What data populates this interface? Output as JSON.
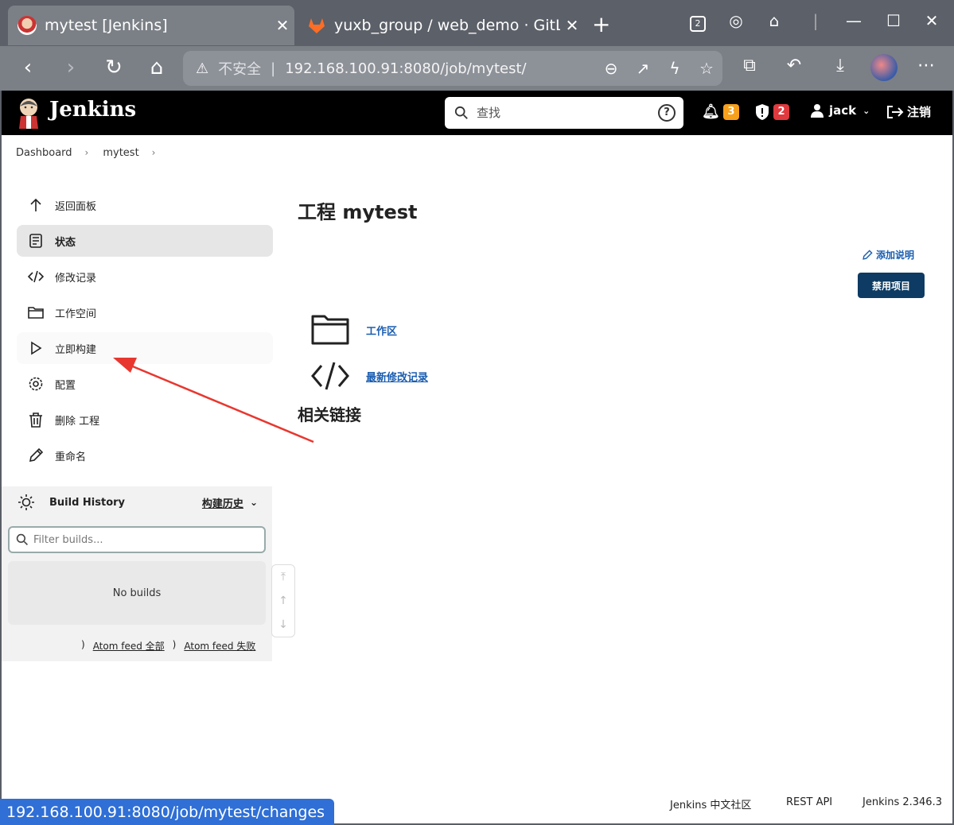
{
  "browser": {
    "tabs": [
      {
        "title": "mytest [Jenkins]",
        "active": true
      },
      {
        "title": "yuxb_group / web_demo · GitLab",
        "active": false
      }
    ],
    "tab_count": "2",
    "insecure_label": "不安全",
    "url": "192.168.100.91:8080/job/mytest/",
    "status_url": "192.168.100.91:8080/job/mytest/changes"
  },
  "header": {
    "brand": "Jenkins",
    "search_placeholder": "查找",
    "notifications_count": "3",
    "security_count": "2",
    "user": "jack",
    "logout": "注销",
    "colors": {
      "notif": "#f7a01b",
      "security": "#e0393e"
    }
  },
  "breadcrumb": [
    "Dashboard",
    "mytest"
  ],
  "sidebar": {
    "items": [
      {
        "label": "返回面板",
        "icon": "arrow-up-icon"
      },
      {
        "label": "状态",
        "icon": "document-icon"
      },
      {
        "label": "修改记录",
        "icon": "code-icon"
      },
      {
        "label": "工作空间",
        "icon": "folder-icon"
      },
      {
        "label": "立即构建",
        "icon": "play-icon"
      },
      {
        "label": "配置",
        "icon": "gear-icon"
      },
      {
        "label": "删除 工程",
        "icon": "trash-icon"
      },
      {
        "label": "重命名",
        "icon": "pencil-icon"
      }
    ]
  },
  "build_history": {
    "title": "Build History",
    "link": "构建历史",
    "filter_placeholder": "Filter builds...",
    "empty": "No builds",
    "feed_all": "Atom feed 全部",
    "feed_fail": "Atom feed 失败"
  },
  "main": {
    "title": "工程 mytest",
    "add_description": "添加说明",
    "disable_button": "禁用项目",
    "links": [
      {
        "label": "工作区",
        "icon": "folder-icon"
      },
      {
        "label": "最新修改记录",
        "icon": "code-icon"
      }
    ],
    "related": "相关链接"
  },
  "footer": {
    "community": "Jenkins 中文社区",
    "rest_api": "REST API",
    "version": "Jenkins 2.346.3"
  }
}
